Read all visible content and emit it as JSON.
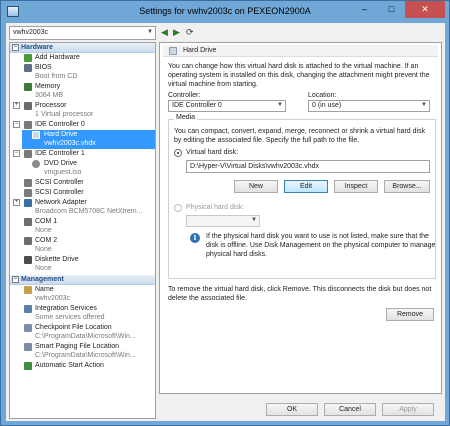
{
  "window": {
    "title": "Settings for vwhv2003c on PEXEON2900A",
    "minimize": "–",
    "maximize": "□",
    "close": "✕"
  },
  "vm_selector": {
    "value": "vwhv2003c"
  },
  "sidebar": {
    "hardware_header": "Hardware",
    "management_header": "Management",
    "hardware_items": [
      {
        "label": "Add Hardware",
        "sub": ""
      },
      {
        "label": "BIOS",
        "sub": "Boot from CD"
      },
      {
        "label": "Memory",
        "sub": "3064 MB"
      },
      {
        "label": "Processor",
        "sub": "1 Virtual processor"
      },
      {
        "label": "IDE Controller 0",
        "sub": ""
      },
      {
        "label": "Hard Drive",
        "sub": "vwhv2003c.vhdx"
      },
      {
        "label": "IDE Controller 1",
        "sub": ""
      },
      {
        "label": "DVD Drive",
        "sub": "vmguest.iso"
      },
      {
        "label": "SCSI Controller",
        "sub": ""
      },
      {
        "label": "SCSI Controller",
        "sub": ""
      },
      {
        "label": "Network Adapter",
        "sub": "Broadcom BCM5708C NetXtrem..."
      },
      {
        "label": "COM 1",
        "sub": "None"
      },
      {
        "label": "COM 2",
        "sub": "None"
      },
      {
        "label": "Diskette Drive",
        "sub": "None"
      }
    ],
    "management_items": [
      {
        "label": "Name",
        "sub": "vwhv2003c"
      },
      {
        "label": "Integration Services",
        "sub": "Some services offered"
      },
      {
        "label": "Checkpoint File Location",
        "sub": "C:\\ProgramData\\Microsoft\\Win..."
      },
      {
        "label": "Smart Paging File Location",
        "sub": "C:\\ProgramData\\Microsoft\\Win..."
      },
      {
        "label": "Automatic Start Action",
        "sub": ""
      }
    ]
  },
  "panel": {
    "header": "Hard Drive",
    "intro": [
      "You can change how this virtual hard disk is attached to the virtual machine. If an",
      "operating system is installed on this disk, changing the attachment might prevent the",
      "virtual machine from starting."
    ],
    "controller_label": "Controller:",
    "controller_value": "IDE Controller 0",
    "location_label": "Location:",
    "location_value": "0 (in use)",
    "media_label": "Media",
    "media_text": [
      "You can compact, convert, expand, merge, reconnect or shrink a virtual hard disk",
      "by editing the associated file. Specify the full path to the file."
    ],
    "virtual_disk_label": "Virtual hard disk:",
    "virtual_disk_path": "D:\\Hyper-V\\Virtual Disks\\vwhv2003c.vhdx",
    "buttons": {
      "new": "New",
      "edit": "Edit",
      "inspect": "Inspect",
      "browse": "Browse..."
    },
    "physical_disk_label": "Physical hard disk:",
    "physical_note": [
      "If the physical hard disk you want to use is not listed, make sure that the",
      "disk is offline. Use Disk Management on the physical computer to manage",
      "physical hard disks."
    ],
    "remove_text": [
      "To remove the virtual hard disk, click Remove. This disconnects the disk but does not",
      "delete the associated file."
    ],
    "remove_button": "Remove"
  },
  "footer": {
    "ok": "OK",
    "cancel": "Cancel",
    "apply": "Apply"
  },
  "colors": {
    "selection": "#3399ff",
    "section_text": "#1f4c86",
    "title_bar": "#6fa7d6"
  }
}
